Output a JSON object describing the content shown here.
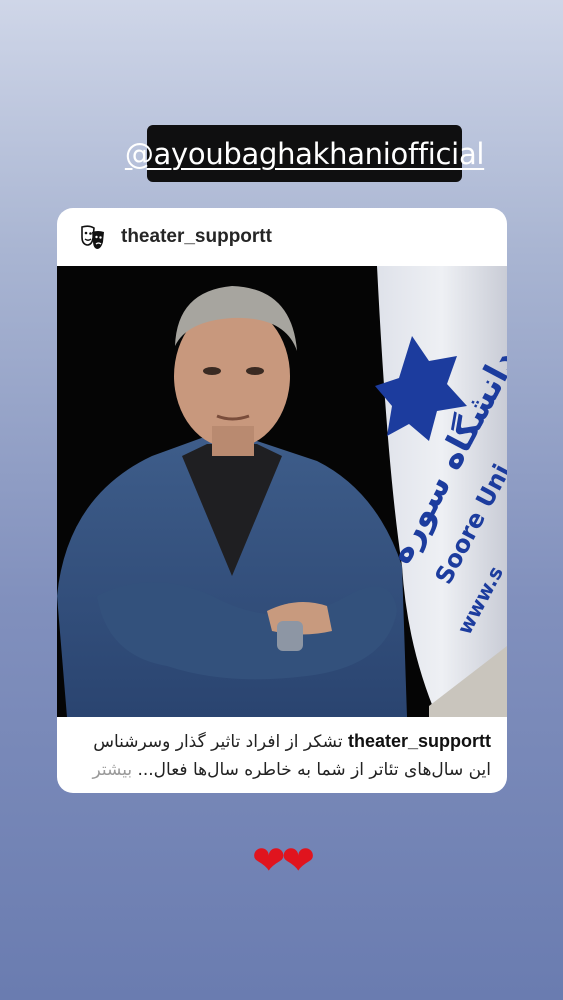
{
  "mention": {
    "handle": "@ayoubaghakhaniofficial"
  },
  "post": {
    "username": "theater_supportt",
    "avatar_icon": "theater-masks-icon",
    "image": {
      "flag_text_arabic": "دانشگاه سوره",
      "flag_text_latin": "Soore Uni",
      "flag_text_url": "www.s"
    },
    "caption": {
      "username": "theater_supportt",
      "line1": "تشکر از افراد تاثیر گذار وسرشناس",
      "line2": "این سال‌های تئاتر از شما به خاطره سال‌ها فعال...",
      "more_label": "بیشتر"
    }
  },
  "sticker": {
    "hearts": "❤❤"
  },
  "colors": {
    "heart": "#e0141e",
    "flag_emblem": "#1c3c9e",
    "flag_fringe": "#c9c5bd"
  }
}
